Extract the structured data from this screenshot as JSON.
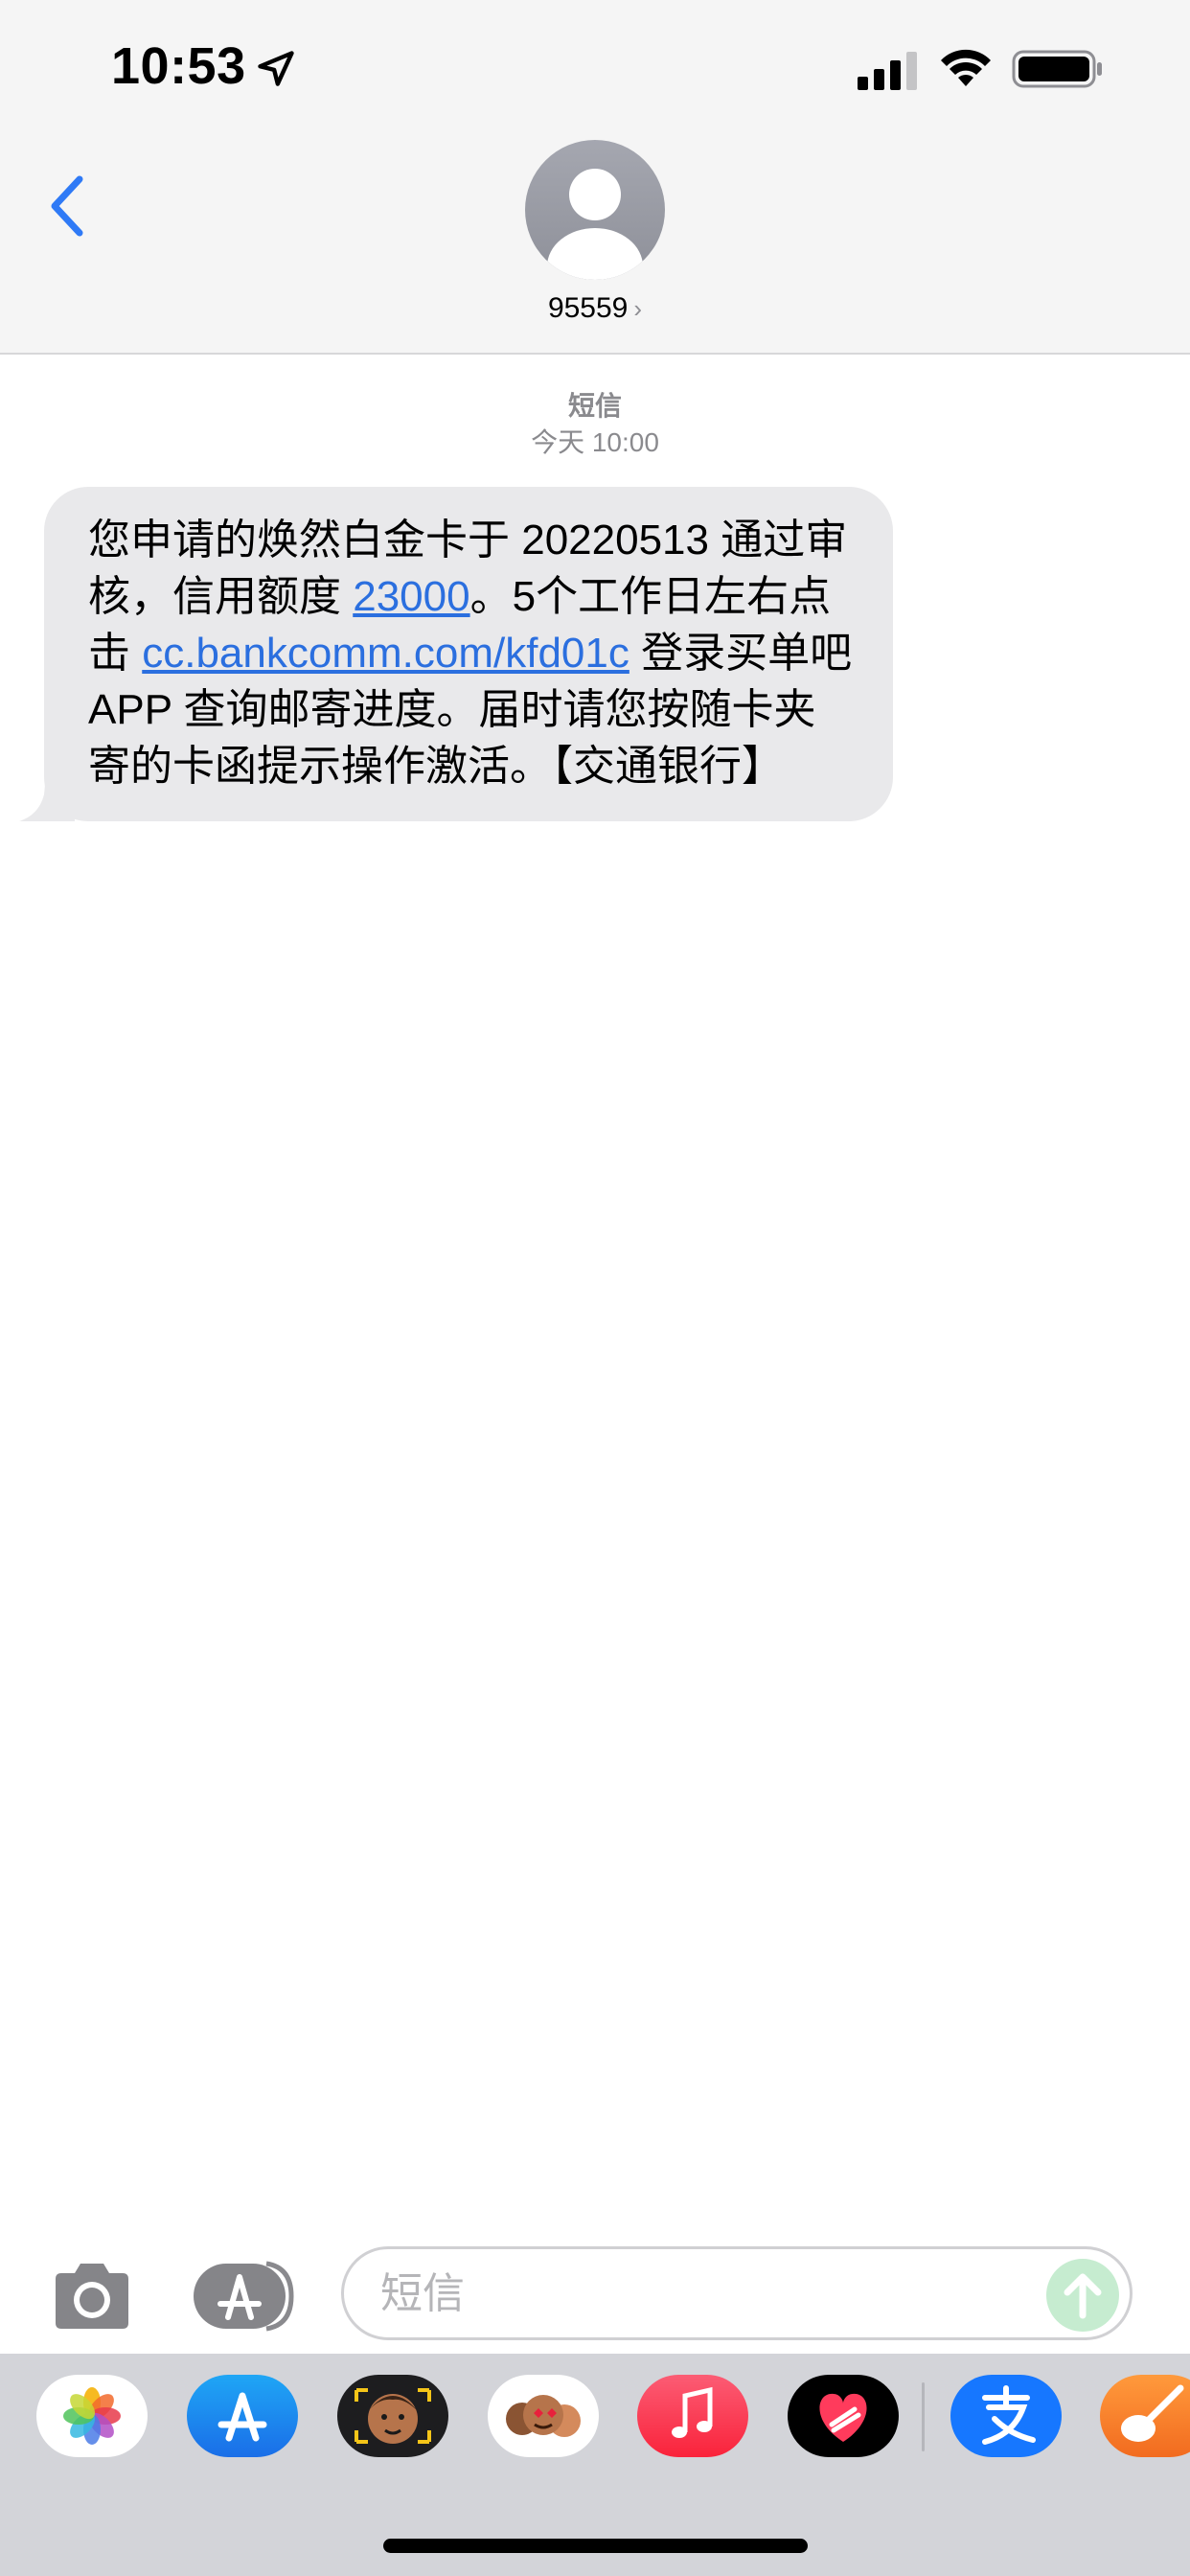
{
  "status_bar": {
    "time": "10:53"
  },
  "header": {
    "contact": "95559"
  },
  "conversation": {
    "kind": "短信",
    "timestamp": "今天 10:00",
    "message": {
      "part1": "您申请的焕然白金卡于 20220513 通过审核，信用额度 ",
      "amount_link": "23000",
      "part2": "。5个工作日左右点击 ",
      "url_link": "cc.bankcomm.com/kfd01c",
      "part3": " 登录买单吧 APP 查询邮寄进度。届时请您按随卡夹寄的卡函提示操作激活。【交通银行】"
    }
  },
  "input_bar": {
    "placeholder": "短信"
  },
  "app_drawer": {
    "apps": [
      {
        "name": "photos-app-icon"
      },
      {
        "name": "app-store-app-icon"
      },
      {
        "name": "memoji-app-icon"
      },
      {
        "name": "memoji-stickers-app-icon"
      },
      {
        "name": "music-app-icon"
      },
      {
        "name": "digital-touch-app-icon"
      },
      {
        "name": "alipay-app-icon"
      },
      {
        "name": "garageband-app-icon"
      }
    ]
  },
  "colors": {
    "header_bg": "#f5f5f5",
    "bubble_bg": "#e9e9eb",
    "link": "#2b6fdf",
    "back_chevron": "#2f7af6",
    "send_disabled": "#c6ecd0"
  }
}
